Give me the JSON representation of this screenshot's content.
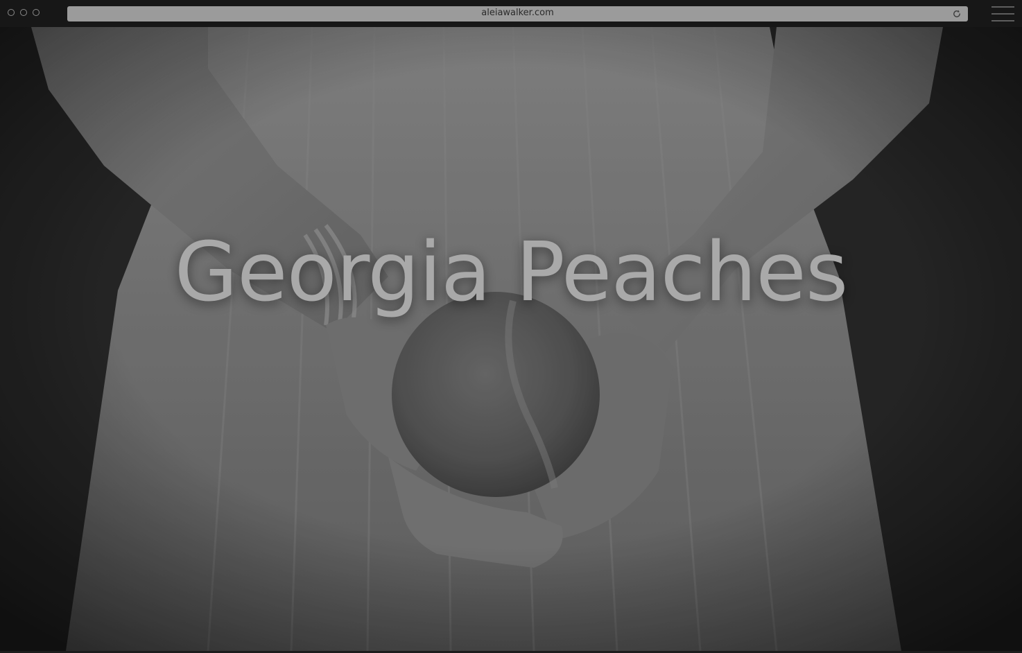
{
  "browser": {
    "url": "aleiawalker.com",
    "icons": {
      "window_controls": "traffic-light-circles",
      "reload": "reload-icon",
      "menu": "hamburger-menu-icon"
    }
  },
  "hero": {
    "title": "Georgia Peaches",
    "image_description_icon": "hands-holding-peach-photo",
    "colors": {
      "title_text": "#a9a9a9",
      "url_bar": "#9b9b9b",
      "chrome_background": "#171717"
    }
  }
}
